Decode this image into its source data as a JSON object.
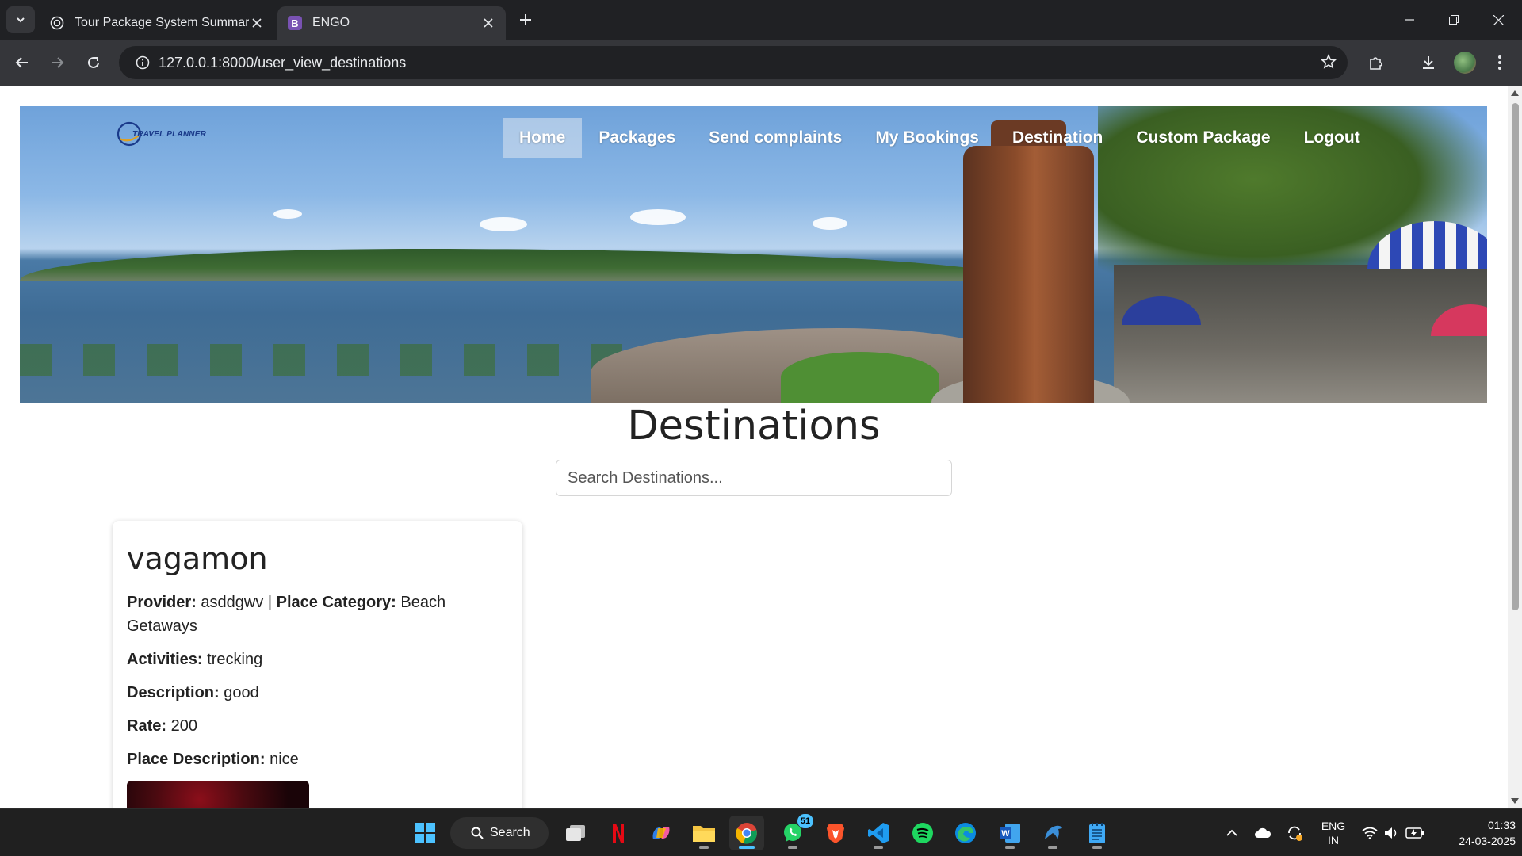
{
  "browser": {
    "tabs": [
      {
        "title": "Tour Package System Summary",
        "icon": "openai-icon"
      },
      {
        "title": "ENGO",
        "icon": "bootstrap-icon",
        "active": true
      }
    ],
    "url": "127.0.0.1:8000/user_view_destinations"
  },
  "site": {
    "logo_text": "TRAVEL PLANNER",
    "nav": [
      "Home",
      "Packages",
      "Send complaints",
      "My Bookings",
      "Destination",
      "Custom Package",
      "Logout"
    ],
    "active_nav": "Home"
  },
  "page": {
    "title": "Destinations",
    "search_placeholder": "Search Destinations..."
  },
  "destination_card": {
    "name": "vagamon",
    "provider_label": "Provider:",
    "provider": "asddgwv",
    "separator": "|",
    "category_label": "Place Category:",
    "category": "Beach Getaways",
    "activities_label": "Activities:",
    "activities": "trecking",
    "description_label": "Description:",
    "description": "good",
    "rate_label": "Rate:",
    "rate": "200",
    "place_description_label": "Place Description:",
    "place_description": "nice"
  },
  "taskbar": {
    "search_label": "Search",
    "whatsapp_badge": "51",
    "lang_top": "ENG",
    "lang_bottom": "IN",
    "time": "01:33",
    "date": "24-03-2025"
  },
  "colors": {
    "chrome_dark": "#202124",
    "chrome_toolbar": "#35363a",
    "taskbar": "#202020",
    "nav_active_bg": "#dce6f0"
  }
}
